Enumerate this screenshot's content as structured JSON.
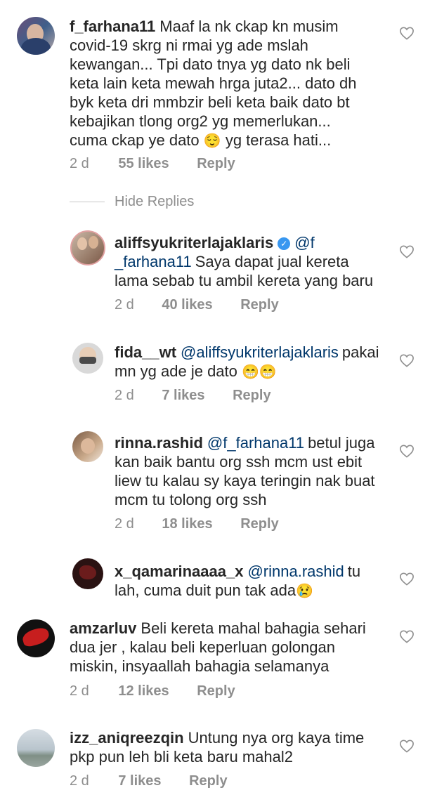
{
  "comments": [
    {
      "user": "f_farhana11",
      "text": "Maaf la nk ckap kn musim covid-19 skrg ni rmai yg ade mslah kewangan... Tpi dato tnya yg dato nk beli keta lain keta mewah hrga juta2... dato dh byk keta dri mmbzir beli keta baik dato bt kebajikan tlong org2 yg memerlukan... cuma ckap ye dato",
      "emoji": "😌",
      "text_after": "yg terasa hati...",
      "time": "2 d",
      "likes": "55 likes",
      "reply": "Reply"
    },
    {
      "user": "aliffsyukriterlajaklaris",
      "verified": true,
      "mention": "@f _farhana11",
      "text": "Saya dapat jual kereta lama sebab tu ambil kereta yang baru",
      "time": "2 d",
      "likes": "40 likes",
      "reply": "Reply"
    },
    {
      "user": "fida__wt",
      "mention": "@aliffsyukriterlajaklaris",
      "text": "pakai mn yg ade je dato",
      "emoji": "😁😁",
      "time": "2 d",
      "likes": "7 likes",
      "reply": "Reply"
    },
    {
      "user": "rinna.rashid",
      "mention": "@f_farhana11",
      "text": "betul juga kan baik bantu org ssh mcm ust ebit liew tu kalau sy kaya teringin nak buat mcm tu tolong org ssh",
      "time": "2 d",
      "likes": "18 likes",
      "reply": "Reply"
    },
    {
      "user": "x_qamarinaaaa_x",
      "mention": "@rinna.rashid",
      "text": "tu lah, cuma duit pun tak ada",
      "emoji": "😢",
      "time": "",
      "likes": "",
      "reply": ""
    },
    {
      "user": "amzarluv",
      "text": "Beli kereta mahal bahagia sehari dua jer , kalau beli keperluan golongan miskin, insyaallah bahagia selamanya",
      "time": "2 d",
      "likes": "12 likes",
      "reply": "Reply"
    },
    {
      "user": "izz_aniqreezqin",
      "text": "Untung nya org kaya time pkp pun leh bli keta baru mahal2",
      "time": "2 d",
      "likes": "7 likes",
      "reply": "Reply"
    }
  ],
  "hide_replies": "Hide Replies",
  "icons": {
    "like": "heart-outline-icon",
    "verified": "verified-badge-icon"
  },
  "colors": {
    "text": "#262626",
    "meta": "#8e8e8e",
    "verified": "#3897f0",
    "mention": "#00376b"
  }
}
